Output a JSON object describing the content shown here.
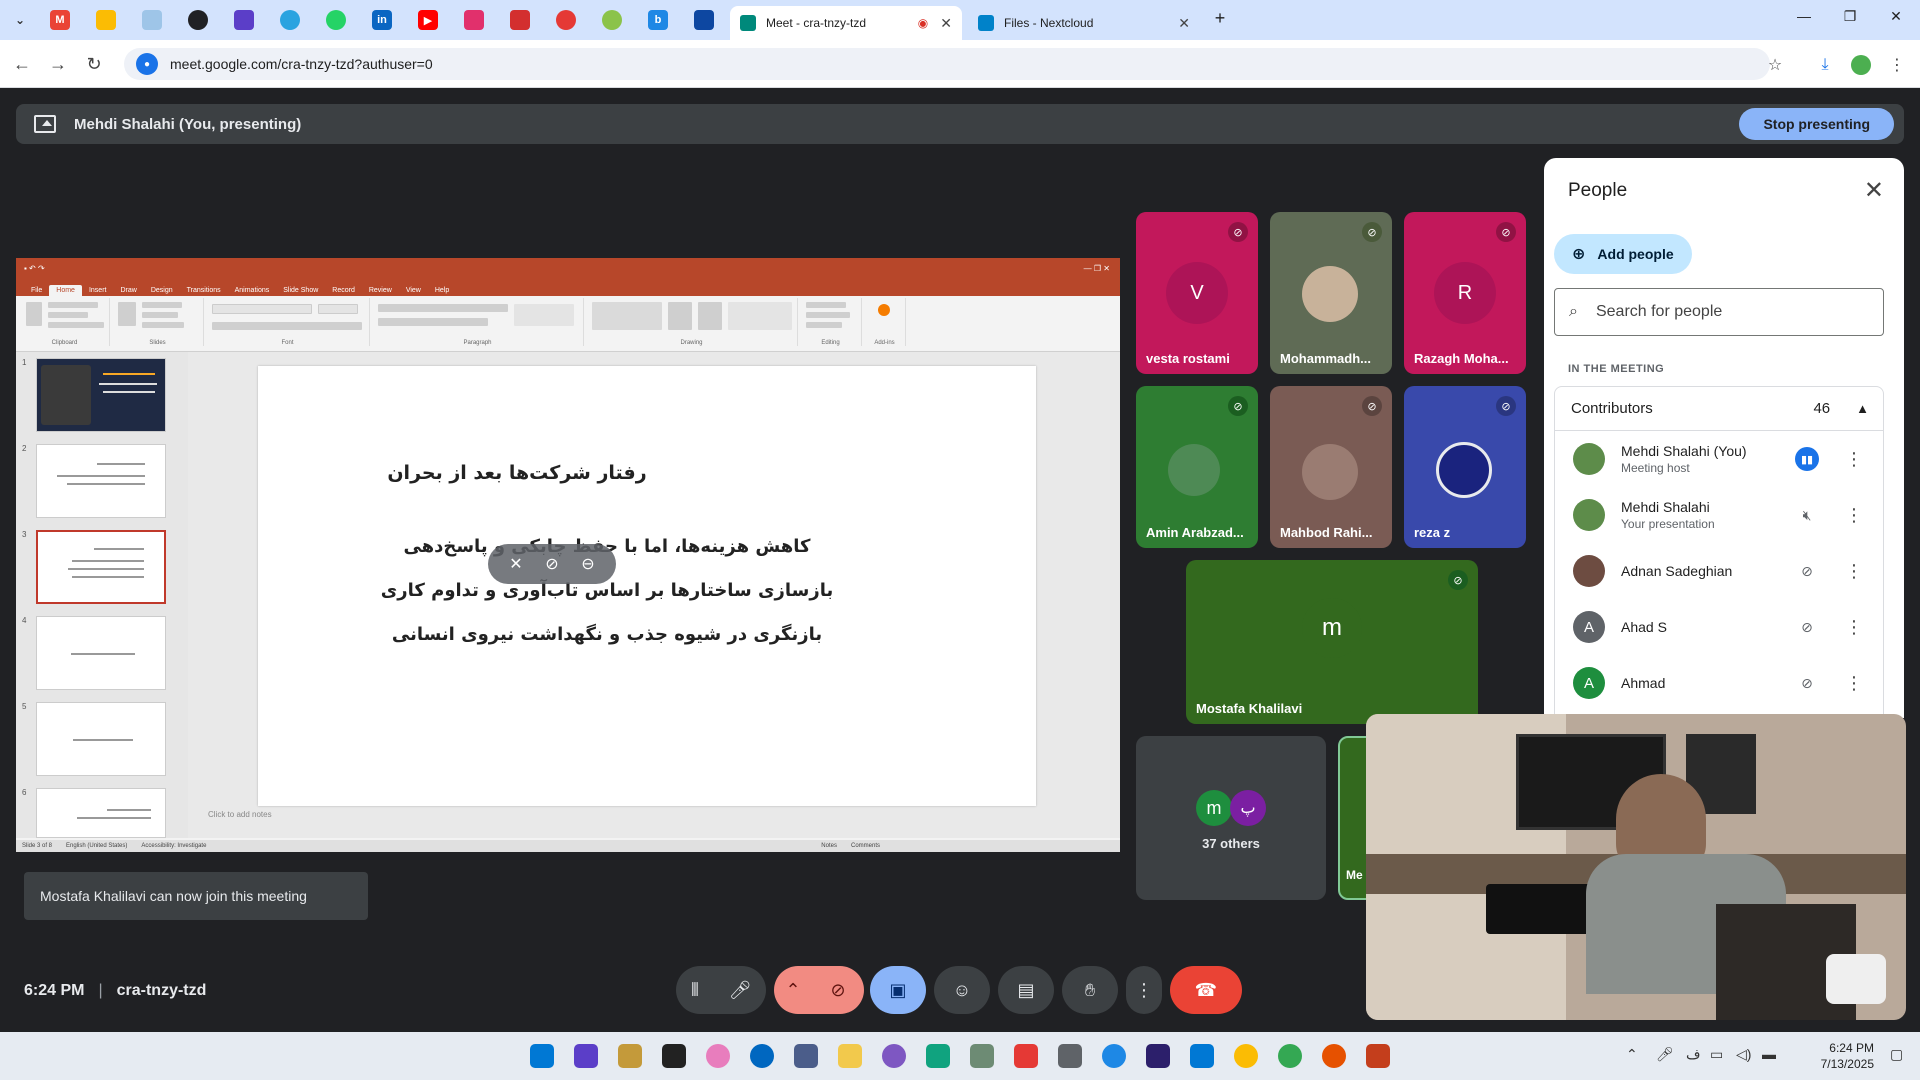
{
  "browser": {
    "tabs": [
      {
        "label": "Meet - cra-tnzy-tzd",
        "active": true
      },
      {
        "label": "Files - Nextcloud",
        "active": false
      }
    ],
    "url": "meet.google.com/cra-tnzy-tzd?authuser=0"
  },
  "presenting": {
    "label": "Mehdi Shalahi (You, presenting)",
    "stop_label": "Stop presenting"
  },
  "slide": {
    "title": "رفتار شرکت‌ها بعد از بحران",
    "bullets": [
      "کاهش هزینه‌ها، اما با حفظ چابکی و پاسخ‌دهی",
      "بازسازی ساختارها بر اساس تاب‌آوری و تداوم کاری",
      "بازنگری در شیوه جذب و نگهداشت نیروی انسانی"
    ],
    "notes_placeholder": "Click to add notes",
    "thumb_numbers": [
      "1",
      "2",
      "3",
      "4",
      "5",
      "6"
    ],
    "ribbon_tabs": [
      "File",
      "Home",
      "Insert",
      "Draw",
      "Design",
      "Transitions",
      "Animations",
      "Slide Show",
      "Record",
      "Review",
      "View",
      "Help"
    ],
    "ribbon_groups": [
      "Clipboard",
      "Slides",
      "Font",
      "Paragraph",
      "Drawing",
      "Editing",
      "Add-ins"
    ],
    "status": [
      "Slide 3 of 8",
      "English (United States)",
      "Accessibility: Investigate",
      "Notes",
      "Comments"
    ]
  },
  "participants": [
    {
      "name": "vesta rostami",
      "initial": "V",
      "color": "#c2185b"
    },
    {
      "name": "Mohammadh...",
      "initial": "",
      "color": "#5f6b55"
    },
    {
      "name": "Razagh Moha...",
      "initial": "R",
      "color": "#c2185b"
    },
    {
      "name": "Amin Arabzad...",
      "initial": "",
      "color": "#2e7d32"
    },
    {
      "name": "Mahbod Rahi...",
      "initial": "",
      "color": "#7a5b54"
    },
    {
      "name": "reza z",
      "initial": "",
      "color": "#3949ab"
    },
    {
      "name": "Mostafa Khalilavi",
      "initial": "m",
      "color": "#33691e"
    }
  ],
  "others": {
    "label": "37 others",
    "initials": [
      "m",
      "پ"
    ],
    "partial_name": "Me"
  },
  "people_panel": {
    "title": "People",
    "add_label": "Add people",
    "search_placeholder": "Search for people",
    "section": "IN THE MEETING",
    "group": "Contributors",
    "count": "46",
    "people": [
      {
        "name": "Mehdi Shalahi (You)",
        "role": "Meeting host",
        "initial": "",
        "color": "#5d8c4a"
      },
      {
        "name": "Mehdi Shalahi",
        "role": "Your presentation",
        "initial": "",
        "color": "#5d8c4a"
      },
      {
        "name": "Adnan Sadeghian",
        "role": "",
        "initial": "",
        "color": "#6d4c41"
      },
      {
        "name": "Ahad S",
        "role": "",
        "initial": "A",
        "color": "#5f6368"
      },
      {
        "name": "Ahmad",
        "role": "",
        "initial": "A",
        "color": "#1e8e3e"
      }
    ]
  },
  "toast": "Mostafa Khalilavi can now join this meeting",
  "meeting": {
    "time": "6:24 PM",
    "code": "cra-tnzy-tzd"
  },
  "taskbar": {
    "time": "6:24 PM",
    "date": "7/13/2025"
  }
}
